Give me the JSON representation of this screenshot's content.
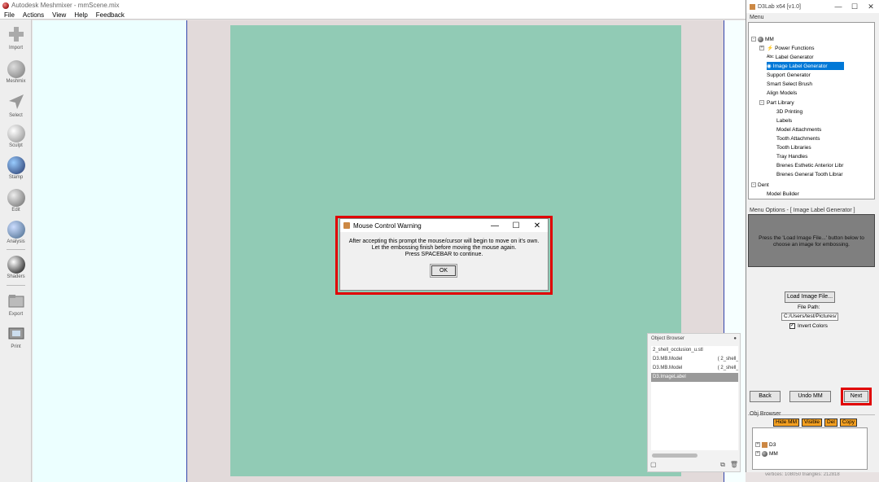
{
  "meshmixer": {
    "title": "Autodesk Meshmixer - mmScene.mix",
    "menu": [
      "File",
      "Actions",
      "View",
      "Help",
      "Feedback"
    ],
    "tools": [
      "Import",
      "Meshmix",
      "Select",
      "Sculpt",
      "Stamp",
      "Edit",
      "Analysis",
      "Shaders",
      "Export",
      "Print"
    ],
    "status": "vertices: 108050 triangles: 212818"
  },
  "warning_dialog": {
    "title": "Mouse Control Warning",
    "line1": "After accepting this prompt the mouse/cursor will begin to move on it's own.",
    "line2": "Let the embossing finish before moving the mouse again.",
    "line3": "Press SPACEBAR to continue.",
    "ok_label": "OK"
  },
  "object_browser": {
    "title": "Object Browser",
    "rows": [
      {
        "name": "2_shell_occlusion_u.stl",
        "extra": ""
      },
      {
        "name": "D3.MB.Model",
        "extra": "( 2_shell_"
      },
      {
        "name": "D3.MB.Model",
        "extra": "( 2_shell_"
      },
      {
        "name": "D3.ImageLabel",
        "extra": ""
      }
    ]
  },
  "d3lab": {
    "title": "D3Lab x64 [v1.0]",
    "menu_label": "Menu",
    "tree": {
      "mm": "MM",
      "power_functions": "Power Functions",
      "label_generator": "Label Generator",
      "label_prefix": "Abc",
      "image_label_generator": "Image Label Generator",
      "support_generator": "Support Generator",
      "smart_select_brush": "Smart Select Brush",
      "align_models": "Align Models",
      "part_library": "Part Library",
      "printing_3d": "3D Printing",
      "labels": "Labels",
      "model_attachments": "Model Attachments",
      "tooth_attachments": "Tooth Attachments",
      "tooth_libraries": "Tooth Libraries",
      "tray_handles": "Tray Handles",
      "brenes_esthetic": "Brenes Esthetic Anterior Libr",
      "brenes_general": "Brenes General Tooth Librar",
      "dent": "Dent",
      "model_builder": "Model Builder"
    },
    "menu_options_label": "Menu Options - [ Image Label Generator ]",
    "info_line1": "Press the 'Load Image File...' button below to",
    "info_line2": "choose an image for embossing.",
    "load_button": "Load Image File...",
    "file_path_label": "File Path:",
    "file_path_value": "C:/Users/test/Pictures/",
    "invert_colors_label": "Invert Colors",
    "invert_colors_checked": true,
    "back_button": "Back",
    "undo_button": "Undo MM",
    "next_button": "Next",
    "obj_browser_label": "Obj Browser",
    "obj_buttons": [
      "Hide MM",
      "Visible",
      "Del",
      "Copy"
    ],
    "obj_tree": [
      "D3",
      "MM"
    ]
  }
}
